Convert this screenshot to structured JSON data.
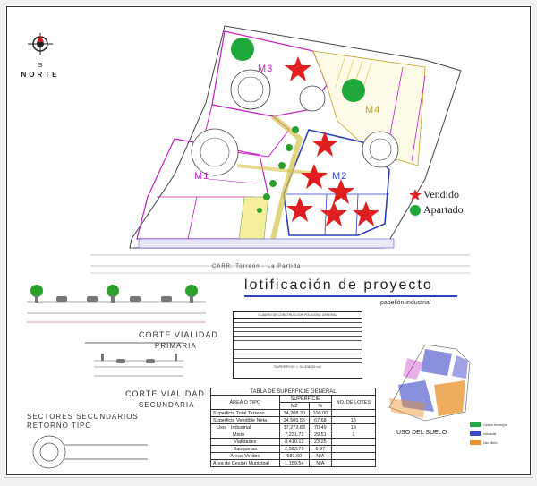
{
  "north": {
    "small_label": "S",
    "label": "NORTE"
  },
  "blocks": {
    "m1": "M1",
    "m2": "M2",
    "m3": "M3",
    "m4": "M4"
  },
  "legend": {
    "vendido": "Vendido",
    "apartado": "Apartado"
  },
  "road_name": "CARR. Torreón - La Partida",
  "title": {
    "main": "lotificación de proyecto",
    "sub": "pabellón industrial"
  },
  "sections": {
    "corte_primaria_1": "CORTE VIALIDAD",
    "corte_primaria_2": "PRIMARIA",
    "corte_secundaria_1": "CORTE VIALIDAD",
    "corte_secundaria_2": "SECUNDARIA",
    "sectores_1": "SECTORES SECUNDARIOS",
    "sectores_2": "RETORNO TIPO"
  },
  "polygon_table": {
    "caption": "CUADRO DE CONSTRUCCION POLIGONO GENERAL",
    "superficie": "SUPERFICIE = 34,208.30 m2"
  },
  "superficie_table": {
    "title": "TABLA DE SUPERFICIE GENERAL",
    "headers": {
      "area": "ÁREA O TIPO",
      "superficie": "SUPERFICIE",
      "lotes": "NO. DE LOTES",
      "m2": "M2",
      "pct": "%"
    },
    "rows": [
      {
        "area": "Superficie Total Terreno",
        "m2": "34,208.30",
        "pct": "100.00",
        "lotes": ""
      },
      {
        "area": "Superficie Vendible Neta",
        "m2": "24,505.55",
        "pct": "67.68",
        "lotes": "15"
      },
      {
        "area": "Industrial",
        "m2": "17,273.83",
        "pct": "70.49",
        "lotes": "13"
      },
      {
        "area": "Mixto",
        "m2": "7,231.72",
        "pct": "29.51",
        "lotes": "2"
      },
      {
        "area": "Vialidades",
        "m2": "8,410.12",
        "pct": "23.25",
        "lotes": ""
      },
      {
        "area": "Banquetas",
        "m2": "2,523.79",
        "pct": "6.97",
        "lotes": ""
      },
      {
        "area": "Áreas Verdes",
        "m2": "581.60",
        "pct": "N/A",
        "lotes": ""
      },
      {
        "area": "Área de Cesión Municipal",
        "m2": "1,159.54",
        "pct": "N/A",
        "lotes": ""
      }
    ],
    "uso_label": "Uso"
  },
  "uso_suelo": {
    "label": "USO DEL SUELO",
    "legend": [
      {
        "label": "Cesion Municipal",
        "color": "#22aa44"
      },
      {
        "label": "Industrial",
        "color": "#3b48c8"
      },
      {
        "label": "Uso Mixto",
        "color": "#e8902a"
      }
    ]
  },
  "colors": {
    "accent_blue": "#2b3fbf",
    "vendido_red": "#e02020",
    "apartado_green": "#1ea83c",
    "magenta": "#c020c0"
  }
}
